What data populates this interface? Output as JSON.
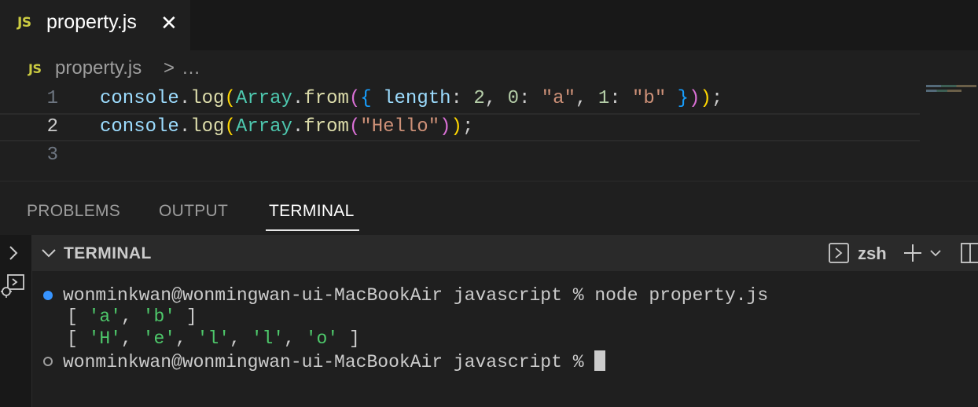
{
  "tab": {
    "badge": "JS",
    "title": "property.js",
    "close": "✕"
  },
  "breadcrumb": {
    "badge": "JS",
    "file": "property.js",
    "sep": ">",
    "ellipsis": "…"
  },
  "editor": {
    "line_numbers": [
      "1",
      "2",
      "3"
    ],
    "line1": {
      "a": "console",
      "b": ".",
      "c": "log",
      "d": "(",
      "e": "Array",
      "f": ".",
      "g": "from",
      "h": "(",
      "i": "{",
      "j": " length",
      "k": ": ",
      "l": "2",
      "m": ", ",
      "n": "0",
      "o": ": ",
      "p": "\"a\"",
      "q": ", ",
      "r": "1",
      "s": ": ",
      "t": "\"b\"",
      "u": " }",
      "v": ")",
      "w": ")",
      "x": ";"
    },
    "line2": {
      "a": "console",
      "b": ".",
      "c": "log",
      "d": "(",
      "e": "Array",
      "f": ".",
      "g": "from",
      "h": "(",
      "i": "\"Hello\"",
      "j": ")",
      "k": ")",
      "l": ";"
    }
  },
  "panel": {
    "tabs": [
      "PROBLEMS",
      "OUTPUT",
      "TERMINAL"
    ],
    "active_tab": "TERMINAL"
  },
  "terminal": {
    "header_title": "TERMINAL",
    "shell": "zsh",
    "prompt": "wonminkwan@wonmingwan-ui-MacBookAir javascript % ",
    "command": "node property.js",
    "out1": {
      "open": "[ ",
      "v1": "'a'",
      "sep": ", ",
      "v2": "'b'",
      "close": " ]"
    },
    "out2": {
      "open": "[ ",
      "v1": "'H'",
      "s1": ", ",
      "v2": "'e'",
      "s2": ", ",
      "v3": "'l'",
      "s3": ", ",
      "v4": "'l'",
      "s4": ", ",
      "v5": "'o'",
      "close": " ]"
    }
  },
  "colors": {
    "accent": "#3794ff",
    "js_badge": "#cbcb41",
    "string": "#ce9178",
    "terminal_string": "#4ec96b"
  }
}
